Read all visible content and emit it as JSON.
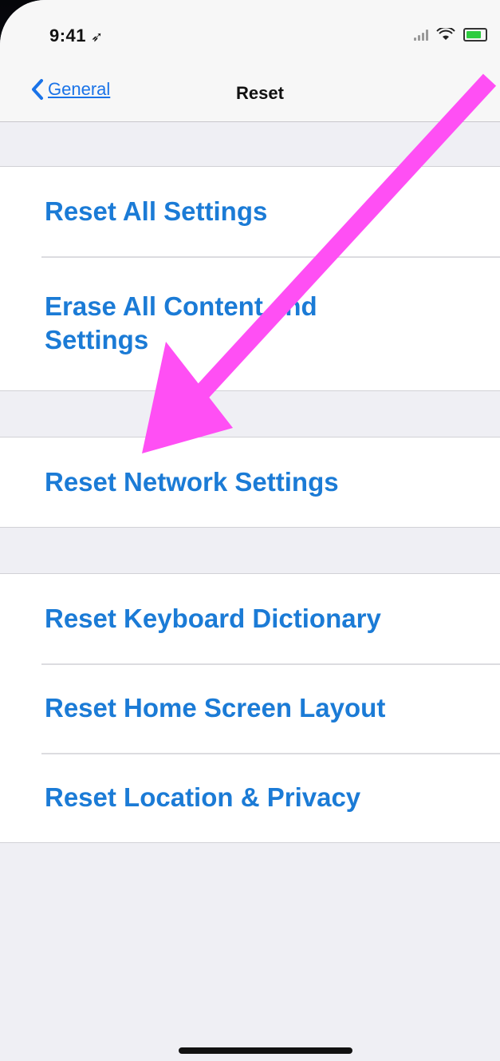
{
  "status_bar": {
    "time": "9:41",
    "location_icon": "location-arrow-icon",
    "signal_icon": "cellular-signal-icon",
    "wifi_icon": "wifi-icon",
    "battery_icon": "battery-icon"
  },
  "nav": {
    "back_label": "General",
    "back_icon": "chevron-left-icon",
    "title": "Reset"
  },
  "groups": [
    {
      "items": [
        "Reset All Settings",
        "Erase All Content and Settings"
      ]
    },
    {
      "items": [
        "Reset Network Settings"
      ]
    },
    {
      "items": [
        "Reset Keyboard Dictionary",
        "Reset Home Screen Layout",
        "Reset Location & Privacy"
      ]
    }
  ],
  "colors": {
    "accent": "#1b7bd6",
    "annotation_arrow": "#ff4ff4",
    "background": "#efeff4"
  }
}
